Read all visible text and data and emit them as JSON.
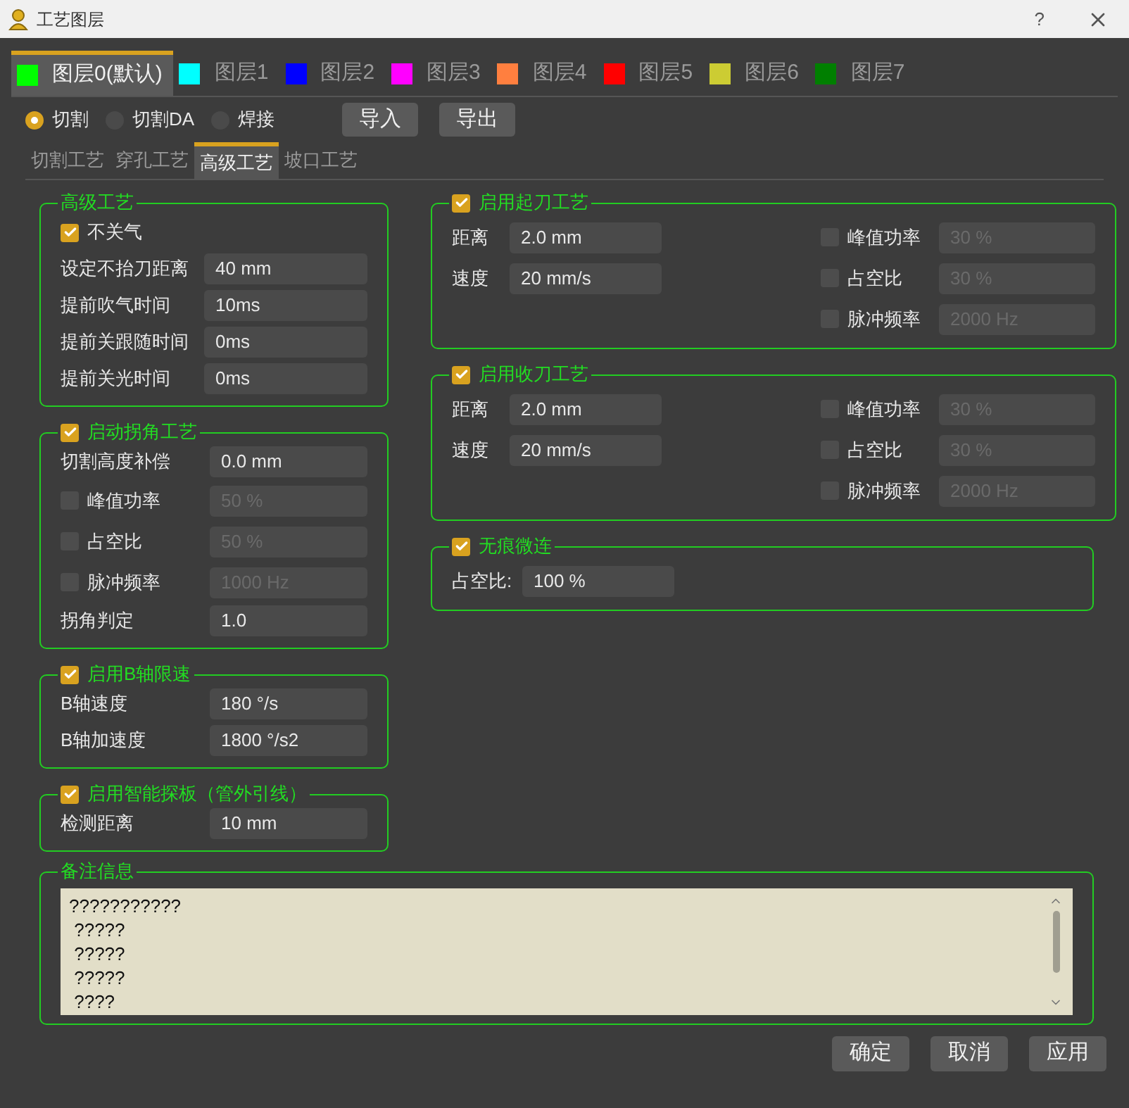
{
  "window": {
    "title": "工艺图层",
    "help": "?"
  },
  "layer_tabs": [
    {
      "label": "图层0(默认)",
      "color": "#00ff00",
      "selected": true
    },
    {
      "label": "图层1",
      "color": "#00ffff",
      "selected": false
    },
    {
      "label": "图层2",
      "color": "#0000ff",
      "selected": false
    },
    {
      "label": "图层3",
      "color": "#ff00ff",
      "selected": false
    },
    {
      "label": "图层4",
      "color": "#ff7f3f",
      "selected": false
    },
    {
      "label": "图层5",
      "color": "#ff0000",
      "selected": false
    },
    {
      "label": "图层6",
      "color": "#cccc33",
      "selected": false
    },
    {
      "label": "图层7",
      "color": "#007f00",
      "selected": false
    }
  ],
  "modes": [
    {
      "label": "切割",
      "selected": true
    },
    {
      "label": "切割DA",
      "selected": false
    },
    {
      "label": "焊接",
      "selected": false
    }
  ],
  "buttons": [
    "导入",
    "导出"
  ],
  "process_tabs": [
    {
      "label": "切割工艺",
      "selected": false
    },
    {
      "label": "穿孔工艺",
      "selected": false
    },
    {
      "label": "高级工艺",
      "selected": true
    },
    {
      "label": "坡口工艺",
      "selected": false
    }
  ],
  "left_groups": [
    {
      "title": "高级工艺",
      "rows": [
        {
          "kind": "checkbox",
          "label": "不关气",
          "checked": true
        },
        {
          "kind": "field",
          "label": "设定不抬刀距离",
          "value": "40 mm"
        },
        {
          "kind": "field",
          "label": "提前吹气时间",
          "value": "10ms"
        },
        {
          "kind": "field",
          "label": "提前关跟随时间",
          "value": "0ms"
        },
        {
          "kind": "field",
          "label": "提前关光时间",
          "value": "0ms"
        }
      ]
    },
    {
      "title": "启动拐角工艺",
      "checked": true,
      "rows": [
        {
          "kind": "field",
          "label": "切割高度补偿",
          "value": "0.0 mm"
        },
        {
          "kind": "check_field",
          "label": "峰值功率",
          "value": "50 %",
          "checked": false
        },
        {
          "kind": "check_field",
          "label": "占空比",
          "value": "50 %",
          "checked": false
        },
        {
          "kind": "check_field",
          "label": "脉冲频率",
          "value": "1000 Hz",
          "checked": false
        },
        {
          "kind": "field",
          "label": "拐角判定",
          "value": "1.0"
        }
      ]
    },
    {
      "title": "启用B轴限速",
      "checked": true,
      "rows": [
        {
          "kind": "field",
          "label": "B轴速度",
          "value": "180 °/s"
        },
        {
          "kind": "field",
          "label": "B轴加速度",
          "value": "1800 °/s2"
        }
      ]
    },
    {
      "title": "启用智能探板（管外引线）",
      "checked": true,
      "rows": [
        {
          "kind": "field",
          "label": "检测距离",
          "value": "10 mm"
        }
      ]
    }
  ],
  "right_groups": [
    {
      "title": "启用起刀工艺",
      "checked": true,
      "rows": [
        {
          "kind": "field",
          "label": "距离",
          "value": "2.0 mm"
        },
        {
          "kind": "field",
          "label": "速度",
          "value": "20 mm/s"
        }
      ],
      "side_rows": [
        {
          "kind": "check_field",
          "label": "峰值功率",
          "value": "30 %",
          "checked": false
        },
        {
          "kind": "check_field",
          "label": "占空比",
          "value": "30 %",
          "checked": false
        },
        {
          "kind": "check_field",
          "label": "脉冲频率",
          "value": "2000 Hz",
          "checked": false
        }
      ]
    },
    {
      "title": "启用收刀工艺",
      "checked": true,
      "rows": [
        {
          "kind": "field",
          "label": "距离",
          "value": "2.0 mm"
        },
        {
          "kind": "field",
          "label": "速度",
          "value": "20 mm/s"
        }
      ],
      "side_rows": [
        {
          "kind": "check_field",
          "label": "峰值功率",
          "value": "30 %",
          "checked": false
        },
        {
          "kind": "check_field",
          "label": "占空比",
          "value": "30 %",
          "checked": false
        },
        {
          "kind": "check_field",
          "label": "脉冲频率",
          "value": "2000 Hz",
          "checked": false
        }
      ]
    },
    {
      "title": "无痕微连",
      "checked": true,
      "rows": [
        {
          "kind": "field",
          "label": "占空比:",
          "value": "100 %"
        }
      ]
    }
  ],
  "notes": {
    "title": "备注信息",
    "lines": [
      "???????????",
      " ?????",
      " ?????",
      " ?????",
      " ????"
    ]
  },
  "footer_buttons": [
    "确定",
    "取消",
    "应用"
  ]
}
